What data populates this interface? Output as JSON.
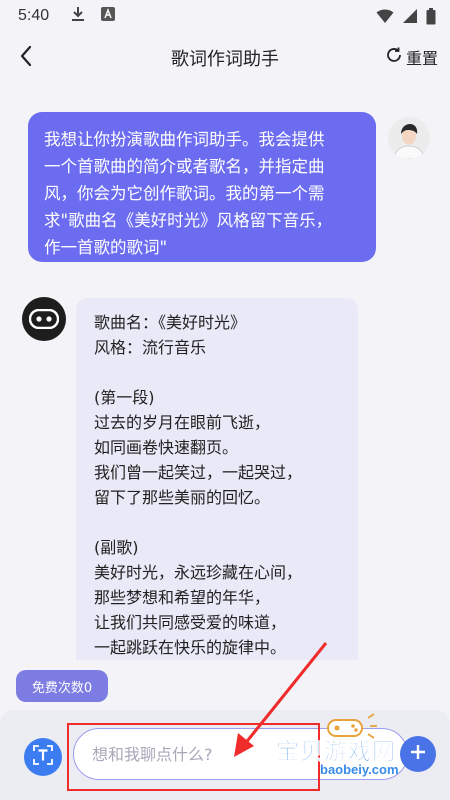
{
  "status_bar": {
    "time": "5:40"
  },
  "header": {
    "title": "歌词作词助手",
    "reset_label": "重置"
  },
  "user_message": {
    "lines": [
      "我想让你扮演歌曲作词助手。我会提供",
      "一个首歌曲的简介或者歌名，并指定曲",
      "风，你会为它创作歌词。我的第一个需",
      "求\"歌曲名《美好时光》风格留下音乐，",
      "作一首歌的歌词\""
    ]
  },
  "bot_message": {
    "song_name": "歌曲名：《美好时光》",
    "style": "风格：流行音乐",
    "verse_heading": "(第一段)",
    "verse_lines": [
      "过去的岁月在眼前飞逝，",
      "如同画卷快速翻页。",
      "我们曾一起笑过，一起哭过，",
      "留下了那些美丽的回忆。"
    ],
    "chorus_heading": "(副歌)",
    "chorus_lines": [
      "美好时光，永远珍藏在心间，",
      "那些梦想和希望的年华，",
      "让我们共同感受爱的味道，",
      "一起跳跃在快乐的旋律中。"
    ]
  },
  "free_count_label": "免费次数0",
  "input": {
    "placeholder": "想和我聊点什么?"
  },
  "watermark": {
    "name": "宝贝游戏网",
    "url": "baobeiy.com"
  },
  "colors": {
    "user_bubble": "#6c6cf0",
    "bot_bubble": "#e9e9f7",
    "accent_blue": "#3b7df0",
    "annotation_red": "#ef2b2b"
  }
}
